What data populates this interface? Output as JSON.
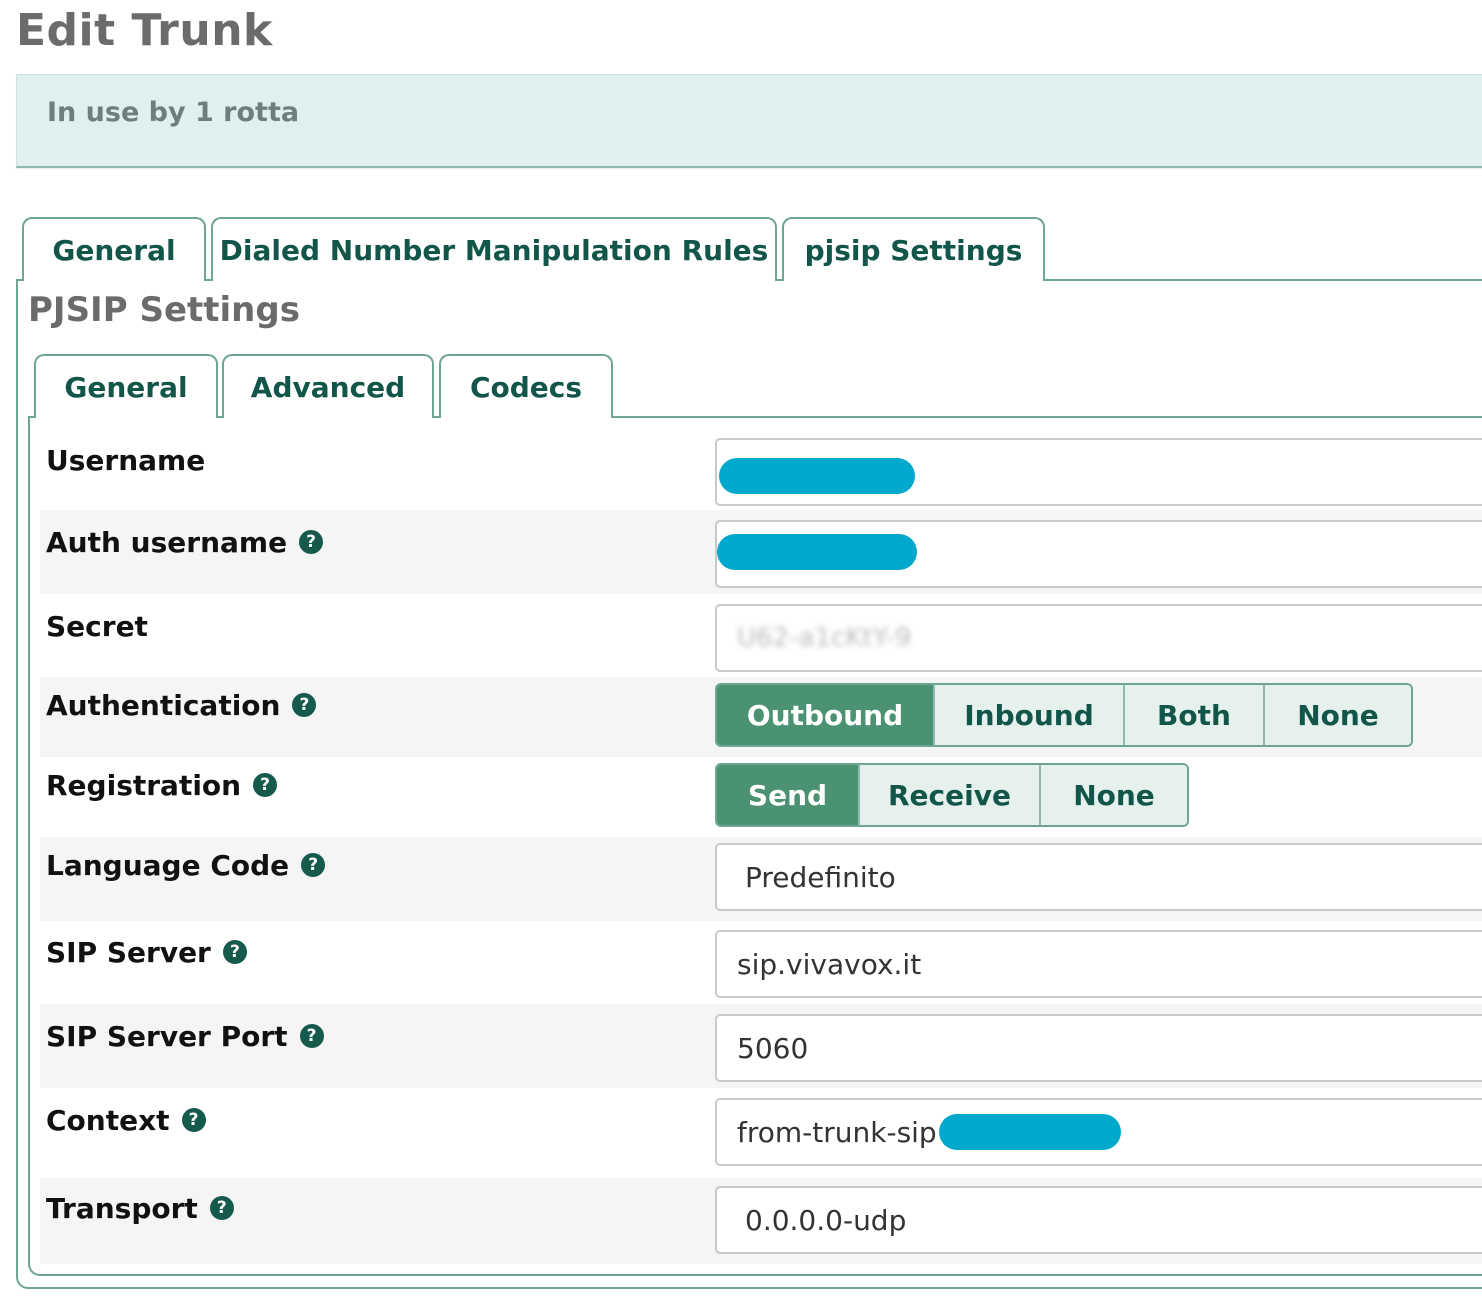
{
  "page": {
    "title": "Edit Trunk"
  },
  "info": {
    "text": "In use by 1 rotta"
  },
  "top_tabs": [
    {
      "label": "General"
    },
    {
      "label": "Dialed Number Manipulation Rules"
    },
    {
      "label": "pjsip Settings"
    }
  ],
  "section": {
    "title": "PJSIP Settings"
  },
  "sub_tabs": [
    {
      "label": "General"
    },
    {
      "label": "Advanced"
    },
    {
      "label": "Codecs"
    }
  ],
  "fields": {
    "username": {
      "label": "Username",
      "value": ""
    },
    "auth_username": {
      "label": "Auth username",
      "value": ""
    },
    "secret": {
      "label": "Secret",
      "value": "U62-a1cKtY-9"
    },
    "authentication": {
      "label": "Authentication",
      "options": [
        "Outbound",
        "Inbound",
        "Both",
        "None"
      ],
      "selected": "Outbound"
    },
    "registration": {
      "label": "Registration",
      "options": [
        "Send",
        "Receive",
        "None"
      ],
      "selected": "Send"
    },
    "language_code": {
      "label": "Language Code",
      "value": "Predefinito"
    },
    "sip_server": {
      "label": "SIP Server",
      "value": "sip.vivavox.it"
    },
    "sip_server_port": {
      "label": "SIP Server Port",
      "value": "5060"
    },
    "context": {
      "label": "Context",
      "value": "from-trunk-sip"
    },
    "transport": {
      "label": "Transport",
      "value": "0.0.0.0-udp"
    }
  },
  "help_glyph": "?",
  "colors": {
    "accent": "#4a9272",
    "tab_text": "#125549",
    "redaction": "#00a9cc"
  }
}
